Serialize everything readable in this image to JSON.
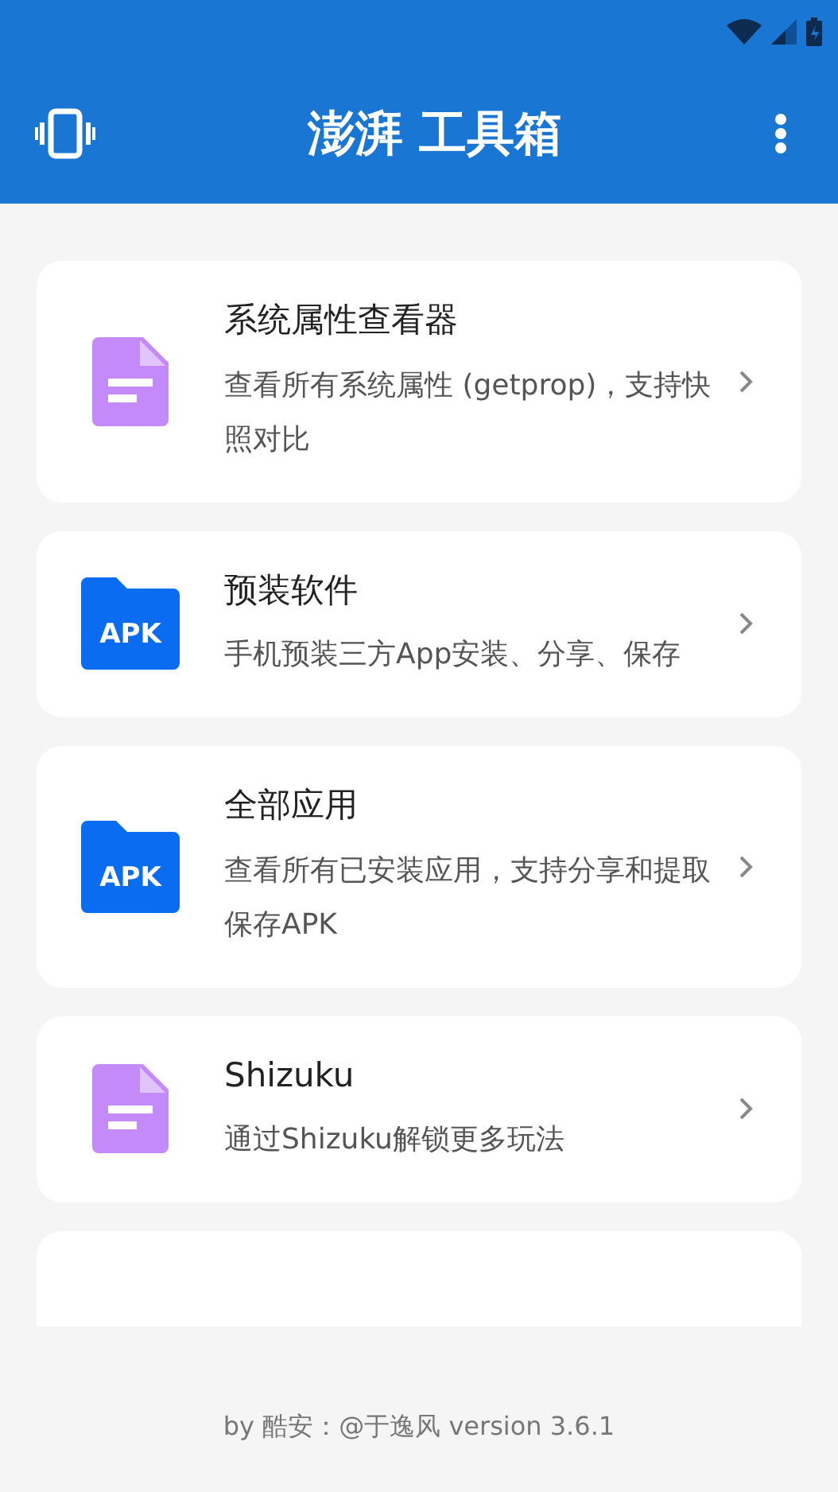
{
  "app_bar": {
    "title": "澎湃 工具箱"
  },
  "items": [
    {
      "kind": "document",
      "title": "系统属性查看器",
      "description": "查看所有系统属性 (getprop)，支持快照对比"
    },
    {
      "kind": "apk",
      "icon_label": "APK",
      "title": "预装软件",
      "description": "手机预装三方App安装、分享、保存"
    },
    {
      "kind": "apk",
      "icon_label": "APK",
      "title": "全部应用",
      "description": "查看所有已安装应用，支持分享和提取保存APK"
    },
    {
      "kind": "document",
      "title": "Shizuku",
      "description": "通过Shizuku解锁更多玩法"
    }
  ],
  "footer": "by 酷安：@于逸风 version 3.6.1"
}
